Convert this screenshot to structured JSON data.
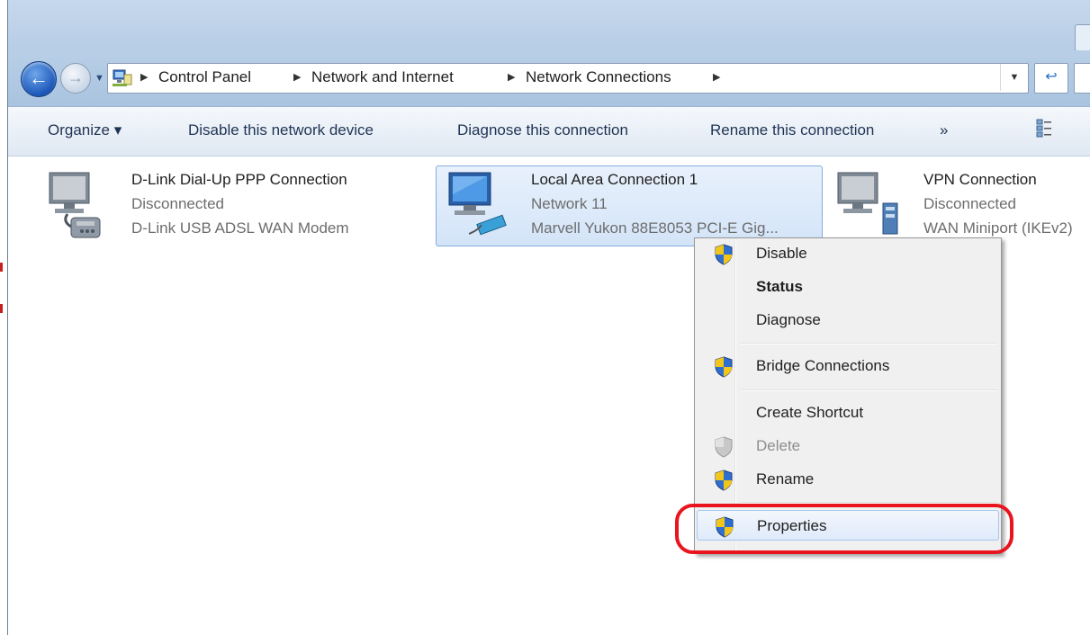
{
  "breadcrumb": {
    "items": [
      "Control Panel",
      "Network and Internet",
      "Network Connections"
    ]
  },
  "toolbar": {
    "organize_label": "Organize ▾",
    "disable_label": "Disable this network device",
    "diagnose_label": "Diagnose this connection",
    "rename_label": "Rename this connection",
    "more_label": "»"
  },
  "connections": [
    {
      "name": "D-Link Dial-Up PPP Connection",
      "status": "Disconnected",
      "device": "D-Link USB ADSL WAN Modem"
    },
    {
      "name": "Local Area Connection 1",
      "status": "Network  11",
      "device": "Marvell Yukon 88E8053 PCI-E Gig...",
      "selected": true
    },
    {
      "name": "VPN Connection",
      "status": "Disconnected",
      "device": "WAN Miniport (IKEv2)"
    }
  ],
  "context_menu": {
    "items": [
      {
        "label": "Disable",
        "shield": true
      },
      {
        "label": "Status",
        "bold": true
      },
      {
        "label": "Diagnose"
      },
      {
        "label": "Bridge Connections",
        "shield": true
      },
      {
        "label": "Create Shortcut"
      },
      {
        "label": "Delete",
        "shield": true,
        "disabled": true
      },
      {
        "label": "Rename",
        "shield": true
      },
      {
        "label": "Properties",
        "shield": true,
        "hover": true
      }
    ]
  },
  "annotation": {
    "color": "#e8141e",
    "target": "Properties"
  }
}
